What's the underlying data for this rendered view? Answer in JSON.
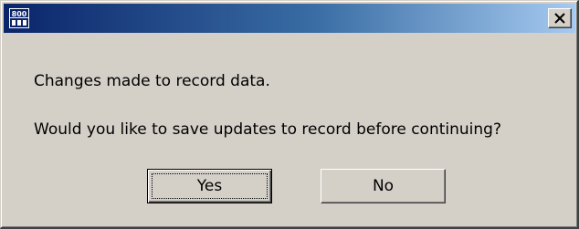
{
  "dialog": {
    "title": "",
    "icon": "app-grid-icon",
    "close_icon": "close-icon",
    "message_line1": "Changes made to record data.",
    "message_line2": "Would you like to save updates to record before continuing?",
    "buttons": {
      "yes_label": "Yes",
      "no_label": "No"
    },
    "colors": {
      "titlebar_start": "#0a246a",
      "titlebar_end": "#a6caf0",
      "face": "#d4d0c8"
    }
  }
}
